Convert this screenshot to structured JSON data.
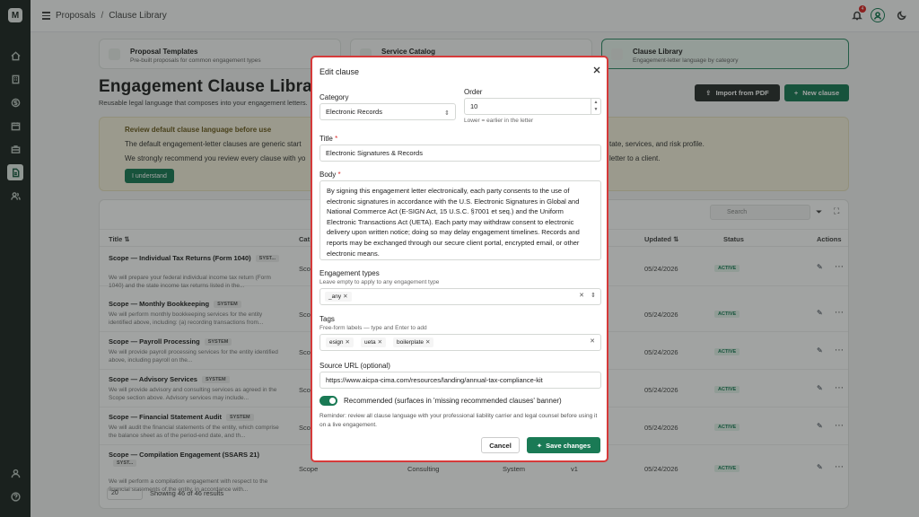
{
  "app": {
    "logo_letter": "M"
  },
  "nav": {
    "items": [
      {
        "icon": "home-icon"
      },
      {
        "icon": "building-icon"
      },
      {
        "icon": "dollar-icon"
      },
      {
        "icon": "calendar-icon"
      },
      {
        "icon": "briefcase-icon"
      },
      {
        "icon": "document-icon",
        "active": true
      },
      {
        "icon": "users-icon"
      }
    ],
    "bottom": [
      {
        "icon": "user-icon"
      },
      {
        "icon": "help-icon"
      }
    ]
  },
  "topbar": {
    "breadcrumb": [
      "Proposals",
      "Clause Library"
    ],
    "notification_count": "4"
  },
  "cards": [
    {
      "title": "Proposal Templates",
      "desc": "Pre-built proposals for common engagement types"
    },
    {
      "title": "Service Catalog",
      "desc": ""
    },
    {
      "title": "Clause Library",
      "desc": "Engagement-letter language by category"
    }
  ],
  "page": {
    "title": "Engagement Clause Library",
    "subtitle": "Reusable legal language that composes into your engagement letters.",
    "import_label": "Import from PDF",
    "new_label": "New clause"
  },
  "banner": {
    "title": "Review default clause language before use",
    "line1": "The default engagement-letter clauses are generic start",
    "line1_right": "tate, services, and risk profile.",
    "line2": "We strongly recommend you review every clause with yo",
    "line2_right": "letter to a client.",
    "button": "I understand"
  },
  "table": {
    "search_placeholder": "Search",
    "headers": {
      "title": "Title ⇅",
      "category": "Cat",
      "updated": "Updated ⇅",
      "status": "Status",
      "actions": "Actions"
    },
    "rows": [
      {
        "title": "Scope — Individual Tax Returns (Form 1040)",
        "tag": "SYST...",
        "desc": "We will prepare your federal individual income tax return (Form 1040) and the state income tax returns listed in the...",
        "category": "Scop",
        "updated": "05/24/2026",
        "status": "ACTIVE"
      },
      {
        "title": "Scope — Monthly Bookkeeping",
        "tag": "SYSTEM",
        "desc": "We will perform monthly bookkeeping services for the entity identified above, including: (a) recording transactions from...",
        "category": "Scop",
        "updated": "05/24/2026",
        "status": "ACTIVE"
      },
      {
        "title": "Scope — Payroll Processing",
        "tag": "SYSTEM",
        "desc": "We will provide payroll processing services for the entity identified above, including payroll on the...",
        "category": "Scop",
        "updated": "05/24/2026",
        "status": "ACTIVE"
      },
      {
        "title": "Scope — Advisory Services",
        "tag": "SYSTEM",
        "desc": "We will provide advisory and consulting services as agreed in the Scope section above. Advisory services may include...",
        "category": "Scop",
        "updated": "05/24/2026",
        "status": "ACTIVE"
      },
      {
        "title": "Scope — Financial Statement Audit",
        "tag": "SYSTEM",
        "desc": "We will audit the financial statements of the entity, which comprise the balance sheet as of the period-end date, and th...",
        "category": "Scop",
        "updated": "05/24/2026",
        "status": "ACTIVE"
      },
      {
        "title": "Scope — Compilation Engagement (SSARS 21)",
        "tag": "SYST...",
        "desc": "We will perform a compilation engagement with respect to the financial statements of the entity, in accordance with...",
        "category": "Scope",
        "col2": "Consulting",
        "col3": "System",
        "col4": "v1",
        "updated": "05/24/2026",
        "status": "ACTIVE"
      }
    ],
    "page_size": "20",
    "showing": "Showing 46 of 46 results"
  },
  "modal": {
    "title": "Edit clause",
    "category_label": "Category",
    "category_value": "Electronic Records",
    "order_label": "Order",
    "order_value": "10",
    "order_hint": "Lower = earlier in the letter",
    "title_label": "Title",
    "title_value": "Electronic Signatures & Records",
    "body_label": "Body",
    "body_value": "By signing this engagement letter electronically, each party consents to the use of electronic signatures in accordance with the U.S. Electronic Signatures in Global and National Commerce Act (E-SIGN Act, 15 U.S.C. §7001 et seq.) and the Uniform Electronic Transactions Act (UETA). Each party may withdraw consent to electronic delivery upon written notice; doing so may delay engagement timelines. Records and reports may be exchanged through our secure client portal, encrypted email, or other electronic means.",
    "eng_types_label": "Engagement types",
    "eng_types_hint": "Leave empty to apply to any engagement type",
    "eng_types_chips": [
      "_any"
    ],
    "tags_label": "Tags",
    "tags_hint": "Free-form labels — type and Enter to add",
    "tags_chips": [
      "esign",
      "ueta",
      "boilerplate"
    ],
    "source_label": "Source URL (optional)",
    "source_value": "https://www.aicpa-cima.com/resources/landing/annual-tax-compliance-kit",
    "recommended_label": "Recommended (surfaces in 'missing recommended clauses' banner)",
    "recommended_on": true,
    "reminder": "Reminder: review all clause language with your professional liability carrier and legal counsel before using it on a live engagement.",
    "cancel_label": "Cancel",
    "save_label": "Save changes"
  }
}
